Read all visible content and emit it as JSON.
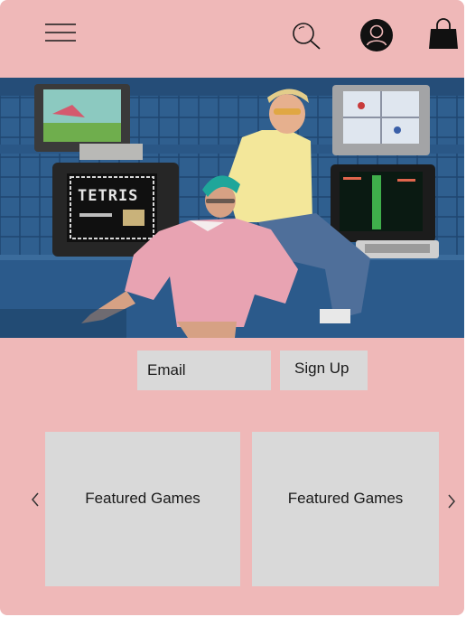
{
  "header": {
    "menu_icon": "hamburger-menu-icon",
    "search_icon": "search-icon",
    "account_icon": "account-icon",
    "cart_icon": "shopping-bag-icon"
  },
  "hero": {
    "image": "Two people posing in front of stacked retro CRT monitors and TVs showing classic games",
    "screen_text": [
      "TETRIS"
    ]
  },
  "signup": {
    "email_placeholder": "Email",
    "button_label": "Sign Up"
  },
  "featured": {
    "cards": [
      {
        "title": "Featured Games"
      },
      {
        "title": "Featured Games"
      }
    ],
    "prev_icon": "chevron-left-icon",
    "next_icon": "chevron-right-icon"
  },
  "colors": {
    "background": "#efb8b8",
    "placeholder_gray": "#d9d9d9",
    "text": "#1a1a1a",
    "icon": "#111111"
  }
}
